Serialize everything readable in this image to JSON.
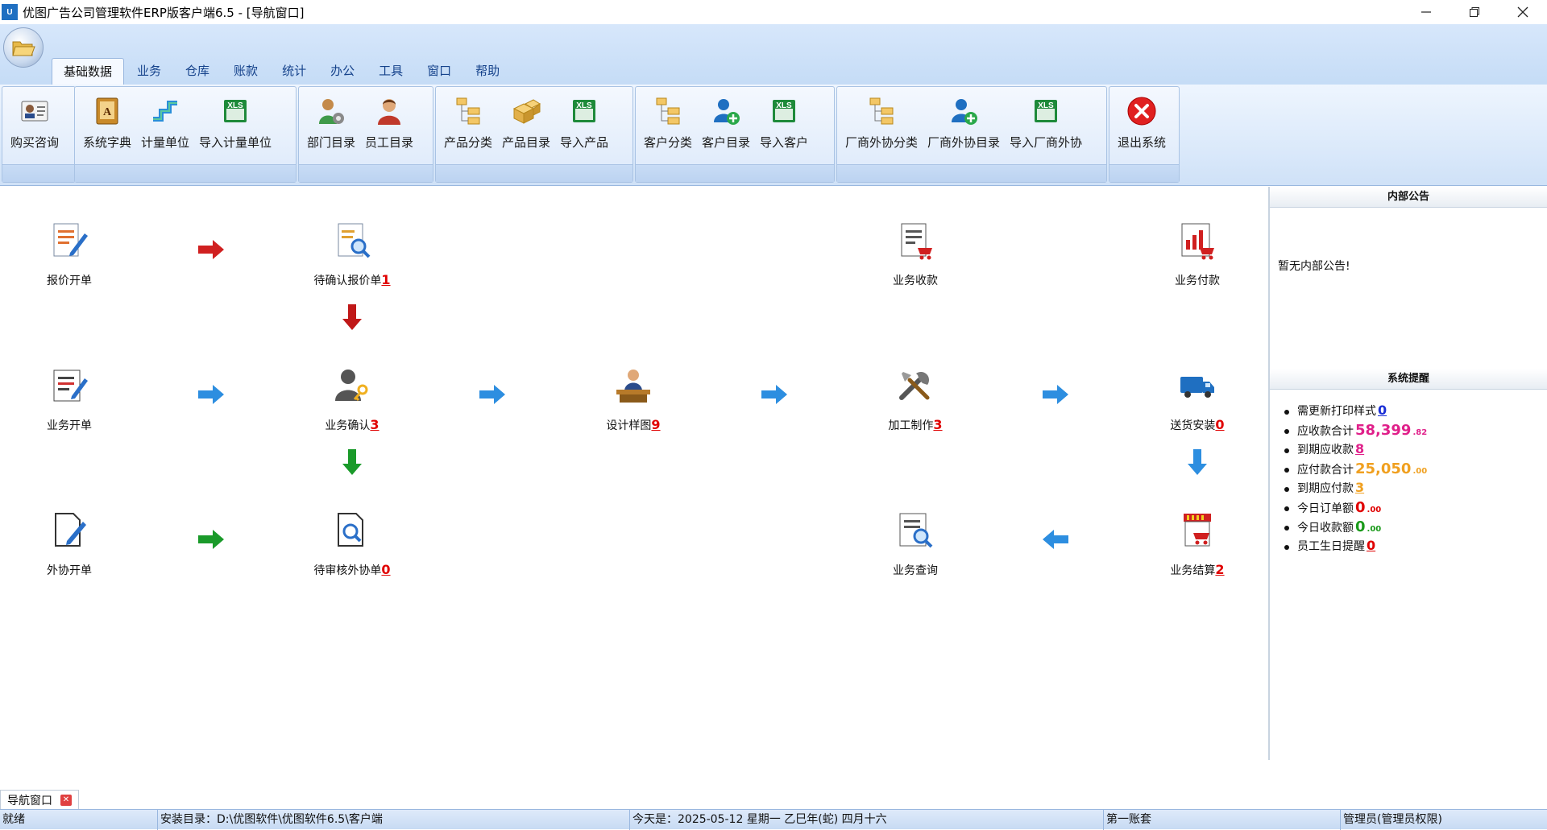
{
  "window": {
    "title": "优图广告公司管理软件ERP版客户端6.5 - [导航窗口]",
    "app_icon_text": "U"
  },
  "tabs": [
    "基础数据",
    "业务",
    "仓库",
    "账款",
    "统计",
    "办公",
    "工具",
    "窗口",
    "帮助"
  ],
  "ribbon": {
    "buttons": [
      {
        "label": "购买咨询",
        "icon": "contact-card-icon"
      },
      {
        "label": "系统字典",
        "icon": "dictionary-icon"
      },
      {
        "label": "计量单位",
        "icon": "unit-icon"
      },
      {
        "label": "导入计量单位",
        "icon": "xls-import-icon"
      },
      {
        "label": "部门目录",
        "icon": "department-icon"
      },
      {
        "label": "员工目录",
        "icon": "employee-icon"
      },
      {
        "label": "产品分类",
        "icon": "tree-category-icon"
      },
      {
        "label": "产品目录",
        "icon": "boxes-icon"
      },
      {
        "label": "导入产品",
        "icon": "xls-import-icon"
      },
      {
        "label": "客户分类",
        "icon": "tree-category-icon"
      },
      {
        "label": "客户目录",
        "icon": "add-user-icon"
      },
      {
        "label": "导入客户",
        "icon": "xls-import-icon"
      },
      {
        "label": "厂商外协分类",
        "icon": "tree-category-icon"
      },
      {
        "label": "厂商外协目录",
        "icon": "add-user-icon"
      },
      {
        "label": "导入厂商外协",
        "icon": "xls-import-icon"
      },
      {
        "label": "退出系统",
        "icon": "exit-icon"
      }
    ]
  },
  "flow": {
    "quote_open": "报价开单",
    "quote_pending": "待确认报价单",
    "quote_pending_count": "1",
    "receipt": "业务收款",
    "payment": "业务付款",
    "order_open": "业务开单",
    "order_confirm": "业务确认",
    "order_confirm_count": "3",
    "design": "设计样图",
    "design_count": "9",
    "production": "加工制作",
    "production_count": "3",
    "delivery": "送货安装",
    "delivery_count": "0",
    "outsource_open": "外协开单",
    "outsource_pending": "待审核外协单",
    "outsource_pending_count": "0",
    "query": "业务查询",
    "settle": "业务结算",
    "settle_count": "2"
  },
  "notice": {
    "title": "内部公告",
    "body": "暂无内部公告!"
  },
  "reminders": {
    "title": "系统提醒",
    "items": [
      {
        "label": "需更新打印样式",
        "value": "0",
        "color": "#1b2fd6"
      },
      {
        "label": "应收款合计",
        "value": "58,399",
        "decimals": ".82",
        "color": "#e0208a"
      },
      {
        "label": "到期应收款",
        "value": "8",
        "color": "#e0208a"
      },
      {
        "label": "应付款合计",
        "value": "25,050",
        "decimals": ".00",
        "color": "#f0a020"
      },
      {
        "label": "到期应付款",
        "value": "3",
        "color": "#f0a020"
      },
      {
        "label": "今日订单额",
        "value": "0",
        "decimals": ".00",
        "color": "#e00000"
      },
      {
        "label": "今日收款额",
        "value": "0",
        "decimals": ".00",
        "color": "#1a9a1a"
      },
      {
        "label": "员工生日提醒",
        "value": "0",
        "color": "#e00000"
      }
    ]
  },
  "doc_tab": "导航窗口",
  "status": {
    "state": "就绪",
    "install_dir": "安装目录：D:\\优图软件\\优图软件6.5\\客户端",
    "today": "今天是：2025-05-12 星期一 乙巳年(蛇) 四月十六",
    "account": "第一账套",
    "user": "管理员(管理员权限)"
  }
}
